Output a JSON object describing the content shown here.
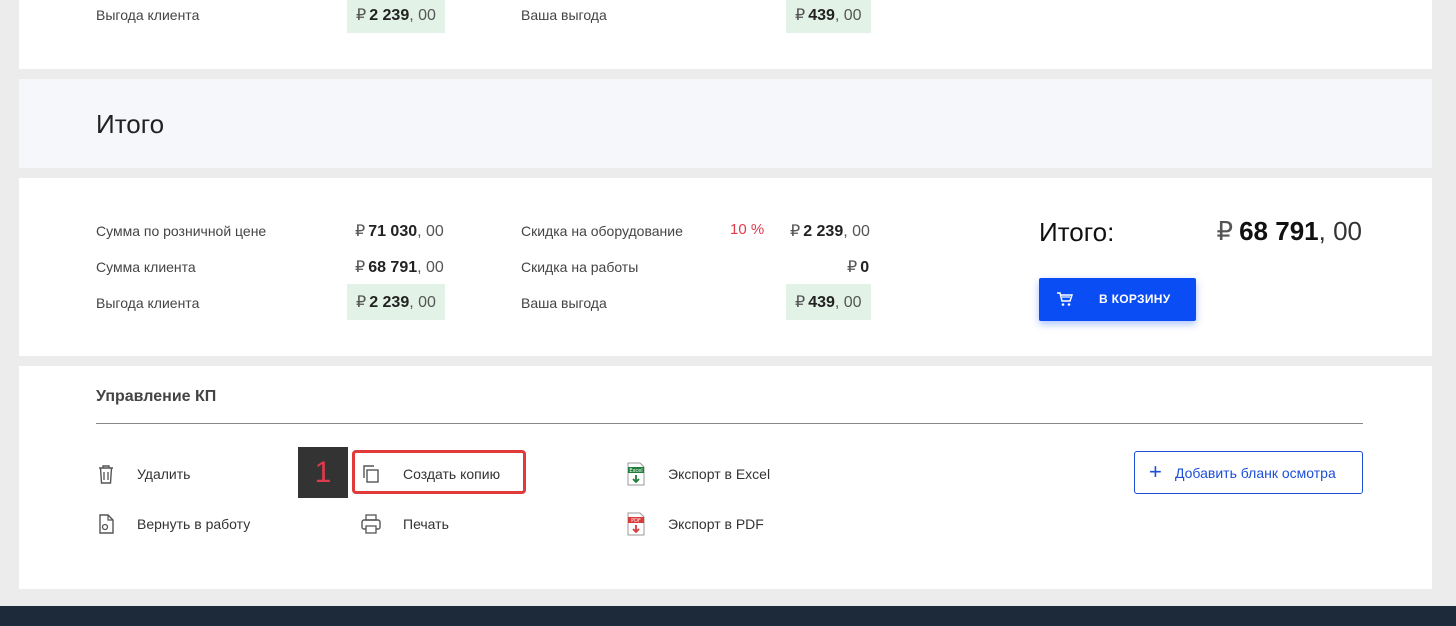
{
  "top_row": {
    "client_benefit_label": "Выгода клиента",
    "client_benefit": {
      "currency": "₽",
      "int": "2 239",
      "dec": ", 00"
    },
    "your_benefit_label": "Ваша выгода",
    "your_benefit": {
      "currency": "₽",
      "int": "439",
      "dec": ", 00"
    }
  },
  "itogo_header": {
    "title": "Итого"
  },
  "summary": {
    "retail_sum_label": "Сумма по розничной цене",
    "retail_sum": {
      "currency": "₽",
      "int": "71 030",
      "dec": ", 00"
    },
    "client_sum_label": "Сумма клиента",
    "client_sum": {
      "currency": "₽",
      "int": "68 791",
      "dec": ", 00"
    },
    "client_benefit_label": "Выгода клиента",
    "client_benefit": {
      "currency": "₽",
      "int": "2 239",
      "dec": ", 00"
    },
    "equipment_discount_label": "Скидка на оборудование",
    "equipment_discount_pct": "10 %",
    "equipment_discount": {
      "currency": "₽",
      "int": "2 239",
      "dec": ", 00"
    },
    "work_discount_label": "Скидка на работы",
    "work_discount": {
      "currency": "₽",
      "int": "0"
    },
    "your_benefit_label": "Ваша выгода",
    "your_benefit": {
      "currency": "₽",
      "int": "439",
      "dec": ", 00"
    },
    "total_label": "Итого:",
    "total": {
      "currency": "₽",
      "int": "68 791",
      "dec": ", 00"
    },
    "cart_button_label": "В КОРЗИНУ"
  },
  "manage": {
    "title": "Управление КП",
    "actions": {
      "delete": "Удалить",
      "return_to_work": "Вернуть в работу",
      "create_copy": "Создать копию",
      "print": "Печать",
      "export_excel": "Экспорт в Excel",
      "export_pdf": "Экспорт в PDF"
    },
    "excel_icon_text": "Excel",
    "pdf_icon_text": "PDF",
    "annotation_badge": "1",
    "add_button_label": "Добавить бланк осмотра"
  },
  "colors": {
    "accent_blue": "#0a4df5",
    "highlight_green": "#e3f2e6",
    "discount_red": "#e03a4e",
    "annotation_red": "#e03a3a"
  }
}
